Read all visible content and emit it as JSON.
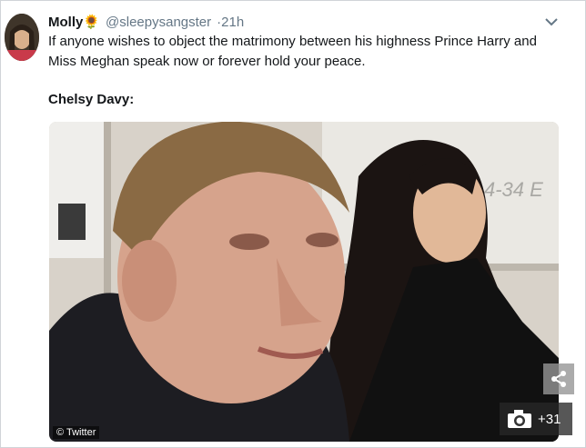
{
  "tweet": {
    "author_name": "Molly",
    "author_emoji": "🌻",
    "handle": "@sleepysangster",
    "separator": "·",
    "time": "21h",
    "text": "If anyone wishes to object the matrimony between his highness Prince Harry and Miss Meghan speak now or forever hold your peace.",
    "quote_label": "Chelsy Davy:"
  },
  "media": {
    "whiteboard_text": "4-34 E",
    "credit": "© Twitter",
    "gallery_count": "+31"
  },
  "icons": {
    "avatar": "avatar",
    "chevron": "chevron-down-icon",
    "share": "share-icon",
    "camera": "camera-icon"
  }
}
